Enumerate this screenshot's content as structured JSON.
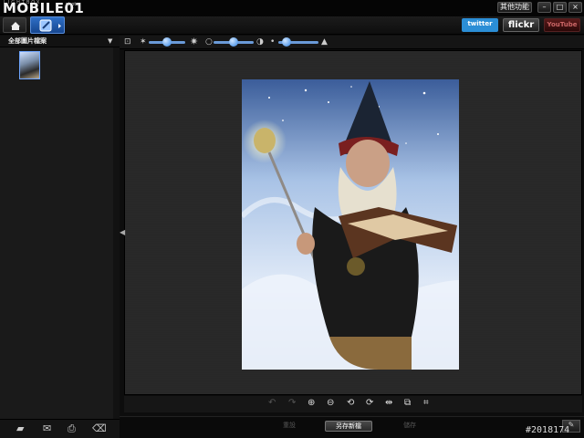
{
  "app": {
    "logo_text": "MOBILE01",
    "logo_small": "LIGHTBOX",
    "logo_tag": "photo"
  },
  "window": {
    "other_label": "其他功能"
  },
  "nav": {
    "twitter_label": "twitter",
    "flickr_label": "flickr",
    "youtube_label": "YouTube"
  },
  "sidebar": {
    "album_label": "全部圖片檔案"
  },
  "actions": {
    "reset_label": "重設",
    "saveas_label": "另存新檔",
    "save_label": "儲存"
  },
  "watermark": "#2018174",
  "icons": {
    "home": "home-icon",
    "edit": "edit-photo-icon",
    "crop": "crop-icon",
    "brightness_low": "sun-small-icon",
    "brightness_high": "sun-large-icon",
    "contrast_low": "contrast-low-icon",
    "contrast_high": "contrast-high-icon",
    "saturation_low": "drop-small-icon",
    "saturation_high": "drop-large-icon"
  },
  "sliders": {
    "brightness": 0.5,
    "contrast": 0.5,
    "saturation": 0.2
  },
  "colors": {
    "accent": "#2d7fe0",
    "twitter": "#2b8ed6",
    "background": "#0d0d0d"
  }
}
